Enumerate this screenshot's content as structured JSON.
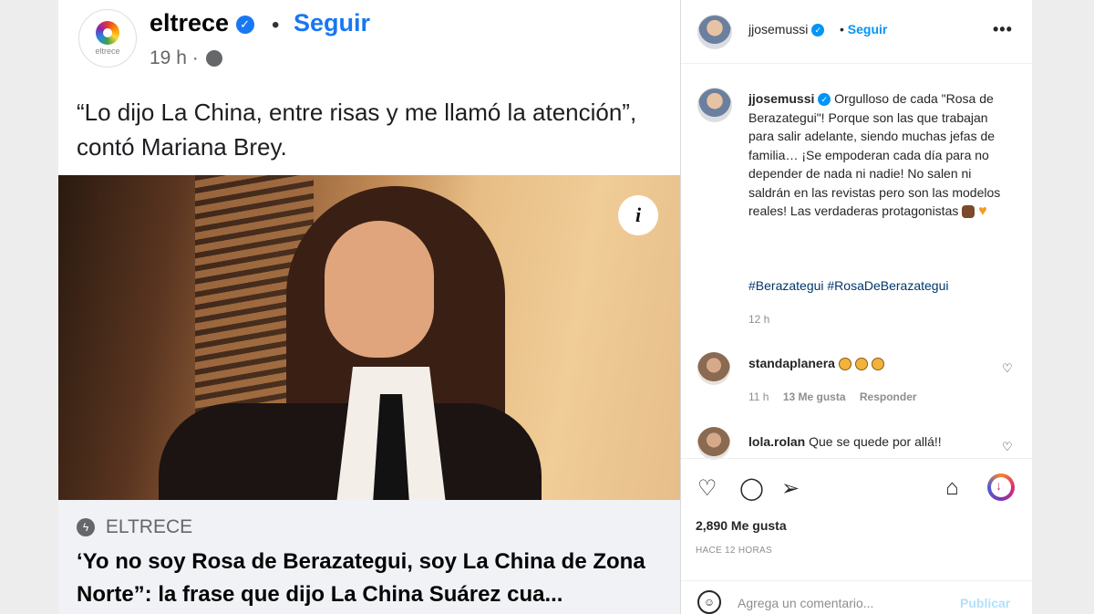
{
  "facebook": {
    "page_name": "eltrece",
    "logo_text": "eltrece",
    "follow": "Seguir",
    "dot": "•",
    "time": "19 h ·",
    "post_text": "“Lo dijo La China, entre risas y me llamó la atención”, contó Mariana Brey.",
    "info_label": "i",
    "link_source": "ELTRECE",
    "link_headline": "‘Yo no soy Rosa de Berazategui, soy La China de Zona Norte”: la frase que dijo La China Suárez cua..."
  },
  "instagram": {
    "username": "jjosemussi",
    "follow": "Seguir",
    "dot": "•",
    "more": "•••",
    "caption": "Orgulloso de cada \"Rosa de Berazategui\"! Porque son las que trabajan para salir adelante, siendo muchas jefas de familia… ¡Se empoderan cada día para no depender de nada ni nadie! No salen ni saldrán en las revistas pero son las modelos reales! Las verdaderas protagonistas",
    "hashtags": "#Berazategui #RosaDeBerazategui",
    "time": "12 h",
    "comments": [
      {
        "user": "standaplanera",
        "text": "",
        "time": "11 h",
        "likes": "13 Me gusta",
        "reply": "Responder"
      },
      {
        "user": "lola.rolan",
        "text": "Que se quede por allá!!"
      }
    ],
    "likes_count": "2,890 Me gusta",
    "ago": "HACE 12 HORAS",
    "comment_placeholder": "Agrega un comentario...",
    "publish": "Publicar"
  },
  "icons": [
    "verified-badge-icon",
    "globe-icon",
    "info-icon",
    "bolt-icon",
    "heart-icon",
    "comment-icon",
    "share-icon",
    "bookmark-icon",
    "smile-icon",
    "more-icon"
  ]
}
